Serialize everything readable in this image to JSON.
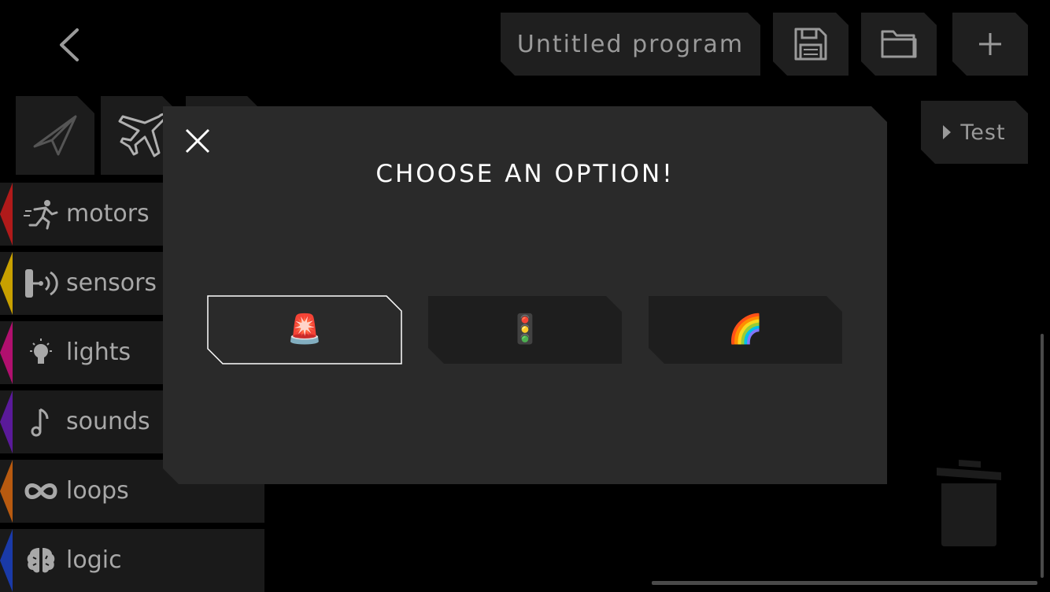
{
  "header": {
    "program_name": "Untitled program"
  },
  "toolbar": {
    "test_label": "Test"
  },
  "categories": [
    {
      "label": "motors",
      "color": "#b01a1a",
      "icon": "running-motor-icon"
    },
    {
      "label": "sensors",
      "color": "#c8a000",
      "icon": "sensor-icon"
    },
    {
      "label": "lights",
      "color": "#b0106e",
      "icon": "lightbulb-icon"
    },
    {
      "label": "sounds",
      "color": "#5a1a9a",
      "icon": "music-note-icon"
    },
    {
      "label": "loops",
      "color": "#b85a10",
      "icon": "infinity-icon"
    },
    {
      "label": "logic",
      "color": "#1a3aa8",
      "icon": "brain-icon"
    }
  ],
  "modal": {
    "title": "CHOOSE AN OPTION!",
    "options": [
      {
        "emoji": "🚨",
        "icon": "siren-icon",
        "selected": true
      },
      {
        "emoji": "🚦",
        "icon": "traffic-light-icon",
        "selected": false
      },
      {
        "emoji": "🌈",
        "icon": "rainbow-icon",
        "selected": false
      }
    ]
  }
}
